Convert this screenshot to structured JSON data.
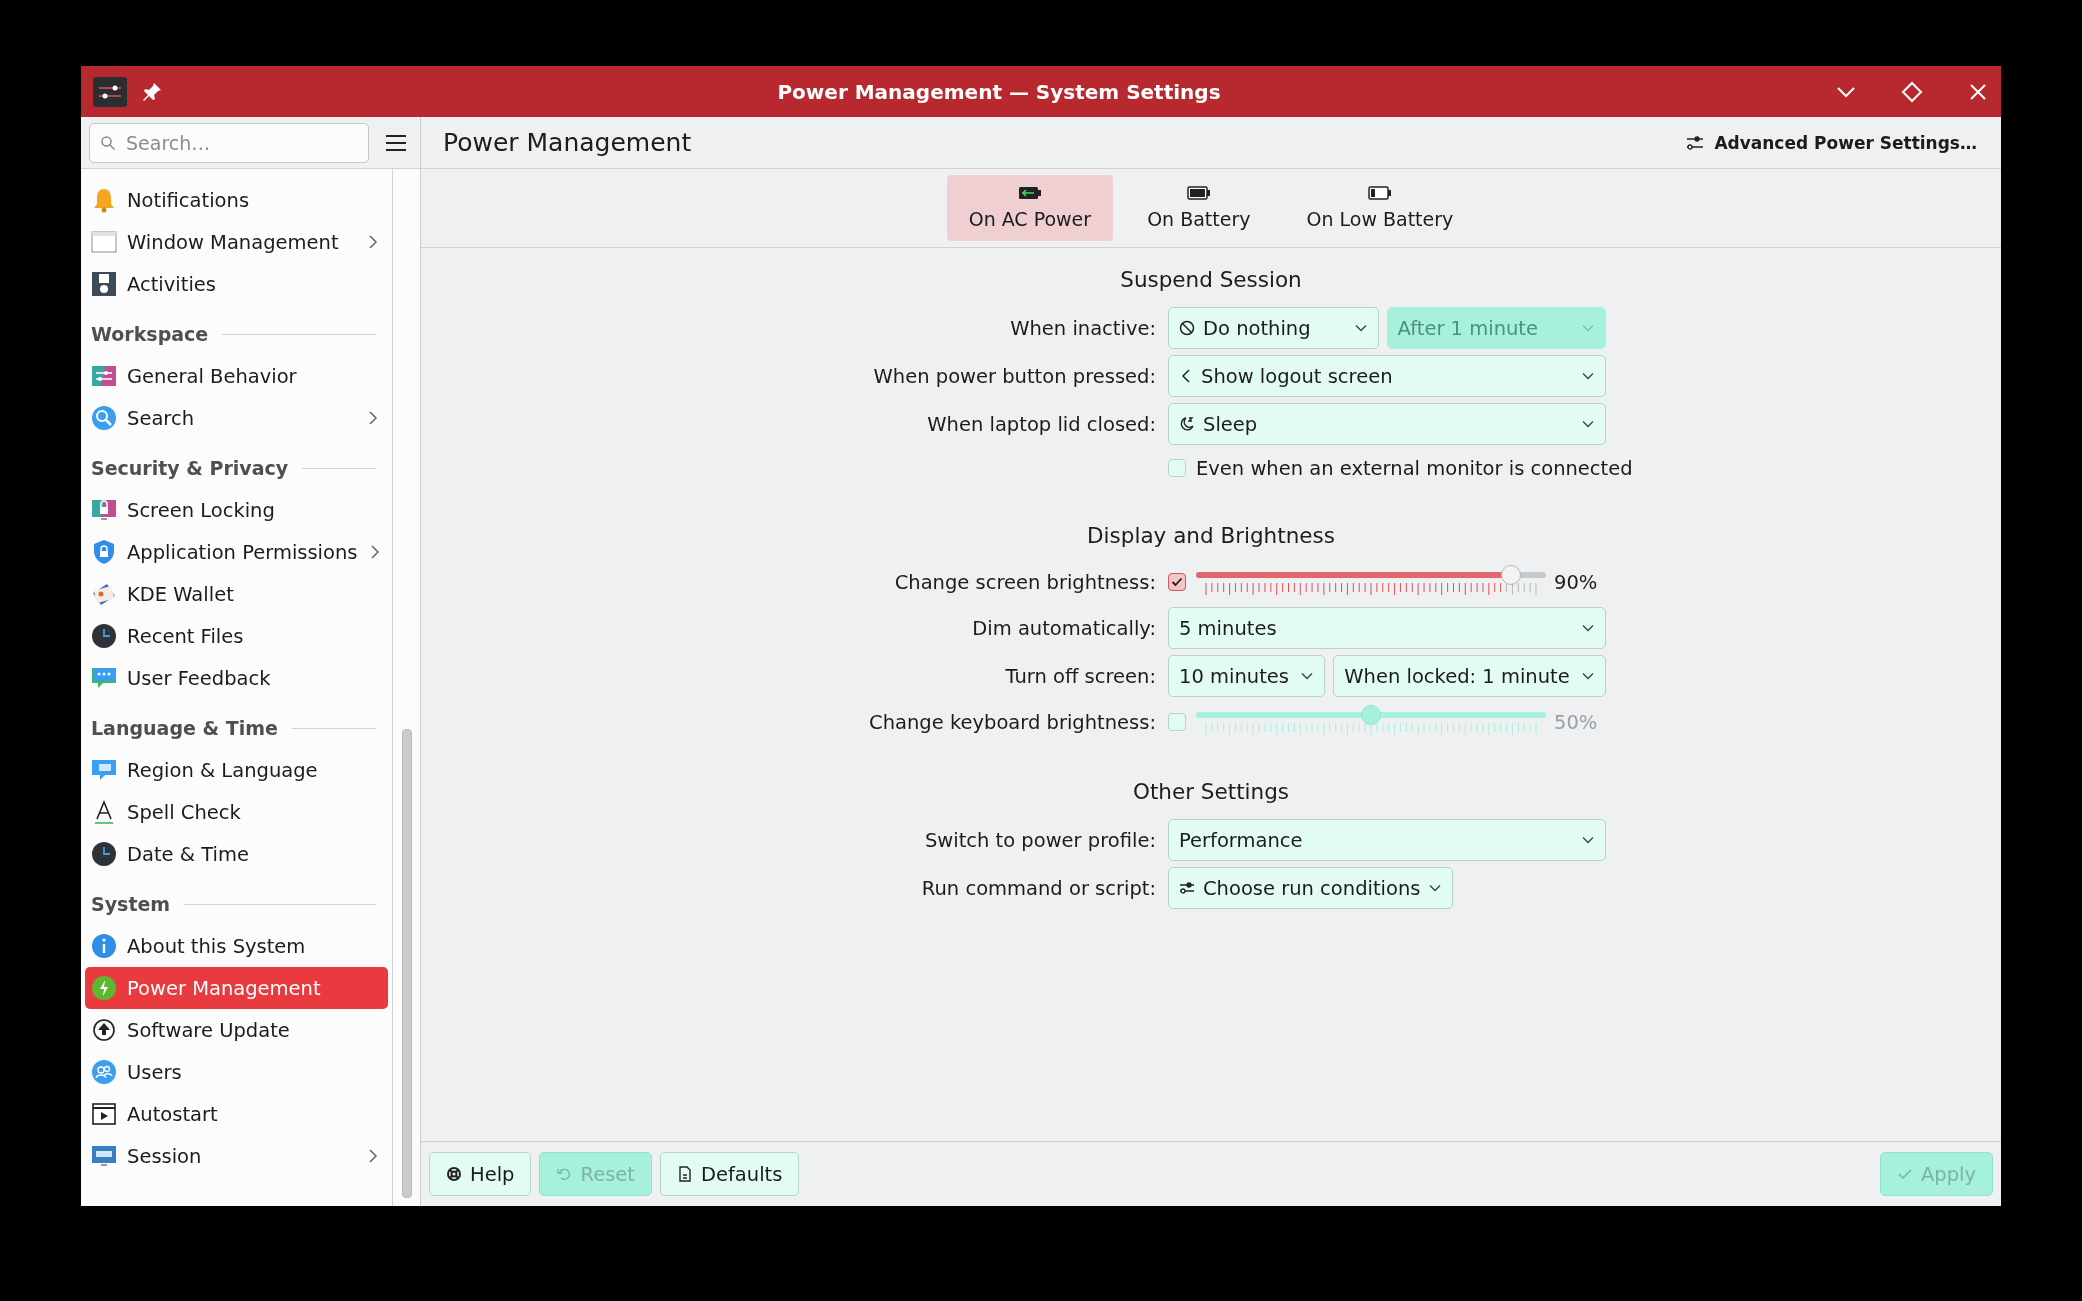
{
  "window": {
    "title": "Power Management — System Settings"
  },
  "sidebar": {
    "search": {
      "placeholder": "Search…"
    },
    "groups": [
      {
        "items": [
          {
            "label": "Notifications",
            "has_children": false,
            "selected": false
          },
          {
            "label": "Window Management",
            "has_children": true,
            "selected": false
          },
          {
            "label": "Activities",
            "has_children": false,
            "selected": false
          }
        ]
      },
      {
        "heading": "Workspace",
        "items": [
          {
            "label": "General Behavior",
            "has_children": false,
            "selected": false
          },
          {
            "label": "Search",
            "has_children": true,
            "selected": false
          }
        ]
      },
      {
        "heading": "Security & Privacy",
        "items": [
          {
            "label": "Screen Locking",
            "has_children": false,
            "selected": false
          },
          {
            "label": "Application Permissions",
            "has_children": true,
            "selected": false
          },
          {
            "label": "KDE Wallet",
            "has_children": false,
            "selected": false
          },
          {
            "label": "Recent Files",
            "has_children": false,
            "selected": false
          },
          {
            "label": "User Feedback",
            "has_children": false,
            "selected": false
          }
        ]
      },
      {
        "heading": "Language & Time",
        "items": [
          {
            "label": "Region & Language",
            "has_children": false,
            "selected": false
          },
          {
            "label": "Spell Check",
            "has_children": false,
            "selected": false
          },
          {
            "label": "Date & Time",
            "has_children": false,
            "selected": false
          }
        ]
      },
      {
        "heading": "System",
        "items": [
          {
            "label": "About this System",
            "has_children": false,
            "selected": false
          },
          {
            "label": "Power Management",
            "has_children": false,
            "selected": true
          },
          {
            "label": "Software Update",
            "has_children": false,
            "selected": false
          },
          {
            "label": "Users",
            "has_children": false,
            "selected": false
          },
          {
            "label": "Autostart",
            "has_children": false,
            "selected": false
          },
          {
            "label": "Session",
            "has_children": true,
            "selected": false
          }
        ]
      }
    ]
  },
  "page": {
    "title": "Power Management",
    "action": "Advanced Power Settings…"
  },
  "tabs": [
    {
      "label": "On AC Power",
      "selected": true
    },
    {
      "label": "On Battery",
      "selected": false
    },
    {
      "label": "On Low Battery",
      "selected": false
    }
  ],
  "sections": [
    {
      "title": "Suspend Session",
      "rows": [
        {
          "kind": "dropdowns",
          "label": "When inactive:",
          "dropdowns": [
            {
              "value": "Do nothing",
              "disabled": false
            },
            {
              "value": "After 1 minute",
              "disabled": true
            }
          ]
        },
        {
          "kind": "dropdowns",
          "label": "When power button pressed:",
          "dropdowns": [
            {
              "value": "Show logout screen",
              "disabled": false
            }
          ]
        },
        {
          "kind": "dropdowns",
          "label": "When laptop lid closed:",
          "dropdowns": [
            {
              "value": "Sleep",
              "disabled": false
            }
          ]
        },
        {
          "kind": "checkbox",
          "text": "Even when an external monitor is connected",
          "checked": false
        }
      ]
    },
    {
      "title": "Display and Brightness",
      "rows": [
        {
          "kind": "slider",
          "label": "Change screen brightness:",
          "checked": true,
          "level": 0.9,
          "reading": "90%"
        },
        {
          "kind": "dropdowns",
          "label": "Dim automatically:",
          "dropdowns": [
            {
              "value": "5 minutes",
              "disabled": false
            }
          ]
        },
        {
          "kind": "dropdowns",
          "label": "Turn off screen:",
          "dropdowns": [
            {
              "value": "10 minutes",
              "disabled": false
            },
            {
              "value": "When locked: 1 minute",
              "disabled": false
            }
          ]
        },
        {
          "kind": "slider",
          "label": "Change keyboard brightness:",
          "checked": false,
          "level": 0.5,
          "reading": "50%"
        }
      ]
    },
    {
      "title": "Other Settings",
      "rows": [
        {
          "kind": "dropdowns",
          "label": "Switch to power profile:",
          "dropdowns": [
            {
              "value": "Performance",
              "disabled": false
            }
          ]
        },
        {
          "kind": "menu",
          "label": "Run command or script:",
          "value": "Choose run conditions"
        }
      ]
    }
  ],
  "footer": {
    "left_buttons": [
      {
        "label": "Help",
        "disabled": false
      },
      {
        "label": "Reset",
        "disabled": true
      },
      {
        "label": "Defaults",
        "disabled": false
      }
    ],
    "right_buttons": [
      {
        "label": "Apply",
        "disabled": true
      }
    ]
  }
}
